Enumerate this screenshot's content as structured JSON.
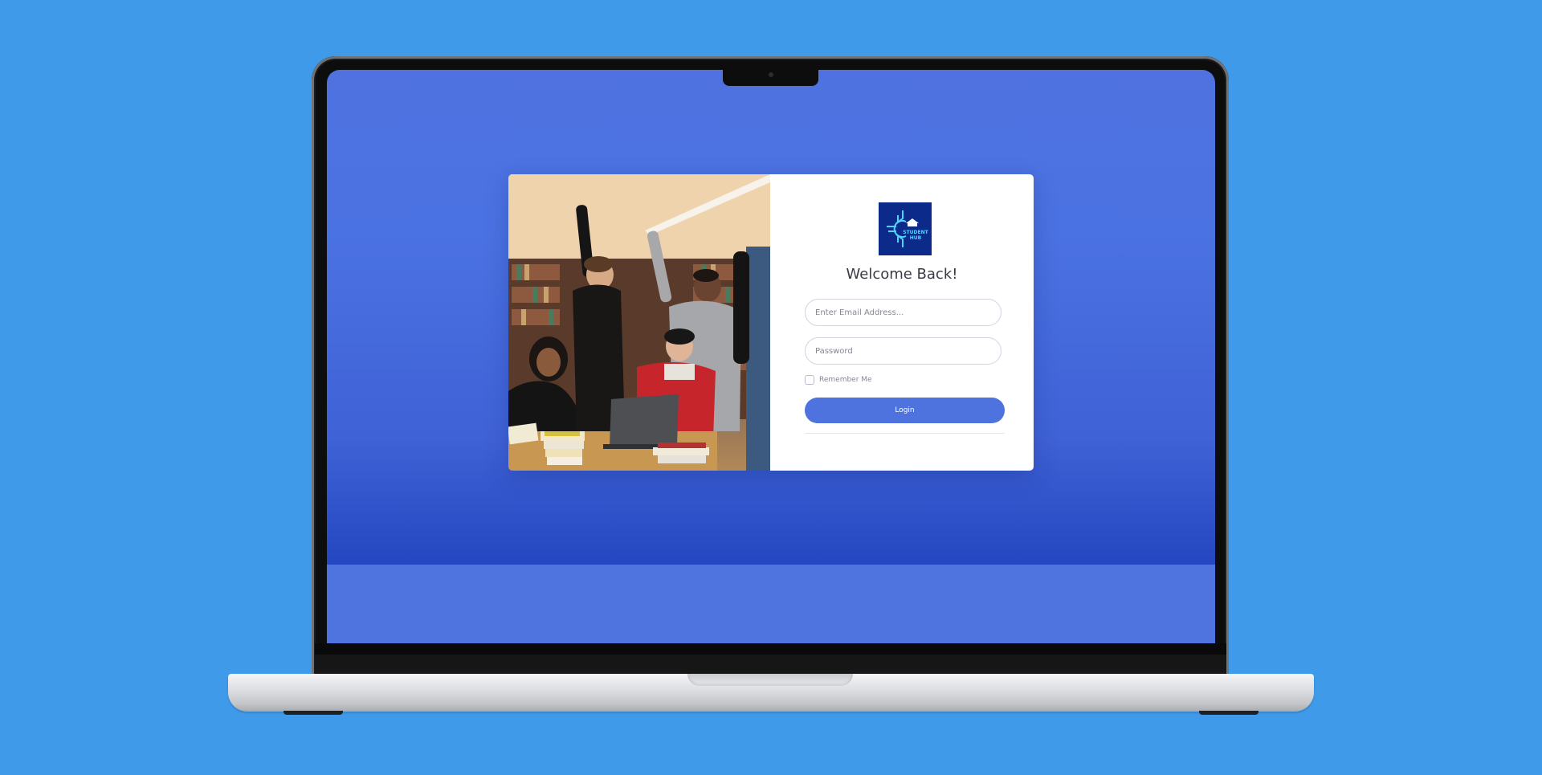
{
  "colors": {
    "page_background": "#3f9aea",
    "screen_background": "#4e73df",
    "primary_button": "#4e73df",
    "card_background": "#ffffff",
    "logo_background": "#0c2a8a",
    "logo_accent": "#4fd3ff"
  },
  "brand": {
    "logo_icon": "student-hub-logo-icon",
    "logo_line1": "STUDENT",
    "logo_line2": "HUB"
  },
  "hero_image": {
    "icon": "students-celebrating-photo"
  },
  "login": {
    "heading": "Welcome Back!",
    "email_placeholder": "Enter Email Address...",
    "email_value": "",
    "password_placeholder": "Password",
    "password_value": "",
    "remember_label": "Remember Me",
    "remember_checked": false,
    "submit_label": "Login"
  }
}
